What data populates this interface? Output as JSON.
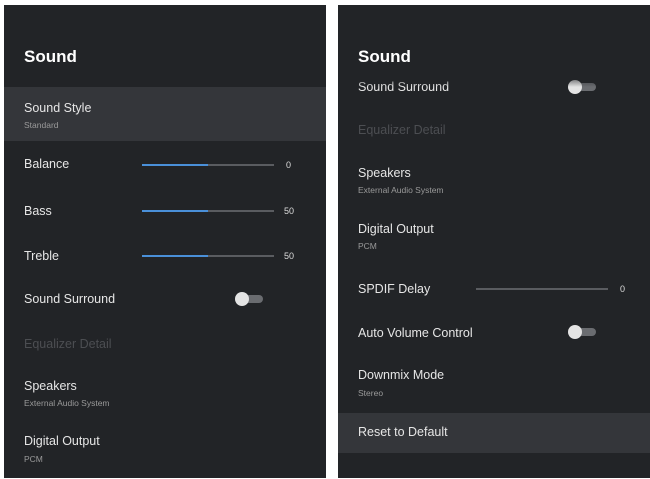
{
  "left": {
    "title": "Sound",
    "sound_style": {
      "label": "Sound Style",
      "value": "Standard"
    },
    "balance": {
      "label": "Balance",
      "value": "0",
      "level": 0.5
    },
    "bass": {
      "label": "Bass",
      "value": "50",
      "level": 0.5
    },
    "treble": {
      "label": "Treble",
      "value": "50",
      "level": 0.5
    },
    "surround": {
      "label": "Sound Surround",
      "state": "off"
    },
    "equalizer": {
      "label": "Equalizer Detail"
    },
    "speakers": {
      "label": "Speakers",
      "value": "External Audio System"
    },
    "digital_output": {
      "label": "Digital Output",
      "value": "PCM"
    }
  },
  "right": {
    "title": "Sound",
    "surround": {
      "label": "Sound Surround",
      "state": "off"
    },
    "equalizer": {
      "label": "Equalizer Detail"
    },
    "speakers": {
      "label": "Speakers",
      "value": "External Audio System"
    },
    "digital_output": {
      "label": "Digital Output",
      "value": "PCM"
    },
    "spdif": {
      "label": "SPDIF Delay",
      "value": "0",
      "level": 0
    },
    "auto_volume": {
      "label": "Auto Volume Control",
      "state": "off"
    },
    "downmix": {
      "label": "Downmix Mode",
      "value": "Stereo"
    },
    "reset": {
      "label": "Reset to Default"
    }
  },
  "colors": {
    "background": "#222427",
    "highlight": "#34363a",
    "accent": "#4a90d9"
  }
}
